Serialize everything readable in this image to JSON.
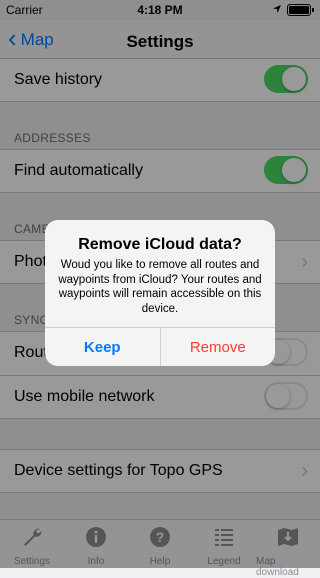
{
  "status": {
    "carrier": "Carrier",
    "time": "4:18 PM"
  },
  "nav": {
    "back_label": "Map",
    "title": "Settings"
  },
  "rows": {
    "save_history": {
      "label": "Save history",
      "toggle": "on"
    },
    "addresses_header": "ADDRESSES",
    "find_automatically": {
      "label": "Find automatically",
      "toggle": "on"
    },
    "camera_header_visible": "CAME",
    "photo_row_visible": "Photo",
    "sync_header_visible": "SYNC",
    "routes_row_visible": "Route",
    "routes_toggle": "off",
    "mobile_network": {
      "label": "Use mobile network",
      "toggle": "off"
    },
    "device_settings": {
      "label": "Device settings for Topo GPS"
    }
  },
  "tabs": [
    {
      "label": "Settings",
      "icon": "wrench-icon"
    },
    {
      "label": "Info",
      "icon": "info-icon"
    },
    {
      "label": "Help",
      "icon": "help-icon"
    },
    {
      "label": "Legend",
      "icon": "legend-icon"
    },
    {
      "label": "Map download",
      "icon": "map-download-icon"
    }
  ],
  "alert": {
    "title": "Remove iCloud data?",
    "message": "Woud you like to remove all routes and waypoints from iCloud? Your routes and waypoints will remain accessible on this device.",
    "keep": "Keep",
    "remove": "Remove"
  },
  "colors": {
    "accent": "#007aff",
    "toggle_on": "#4cd964",
    "destructive": "#ff3b30"
  }
}
